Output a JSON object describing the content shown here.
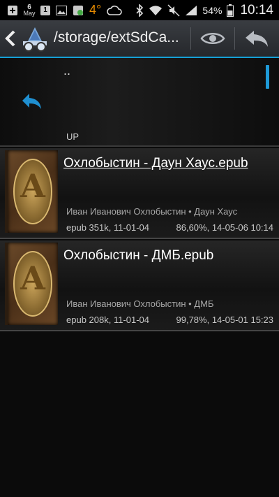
{
  "status_bar": {
    "date_day": "6",
    "date_month": "May",
    "badge_1": "1",
    "temperature": "4°",
    "battery": "54%",
    "time": "10:14"
  },
  "action_bar": {
    "path": "/storage/extSdCa...",
    "accent_color": "#15a0d6"
  },
  "up_row": {
    "dots": "..",
    "label": "UP"
  },
  "books": [
    {
      "title": "Охлобыстин - Даун Хаус.epub",
      "author_line": "Иван Иванович Охлобыстин • Даун Хаус",
      "meta": "epub 351k, 11-01-04",
      "progress": "86,60%, 14-05-06 10:14"
    },
    {
      "title": "Охлобыстин - ДМБ.epub",
      "author_line": "Иван Иванович Охлобыстин • ДМБ",
      "meta": "epub 208k, 11-01-04",
      "progress": "99,78%, 14-05-01 15:23"
    }
  ]
}
